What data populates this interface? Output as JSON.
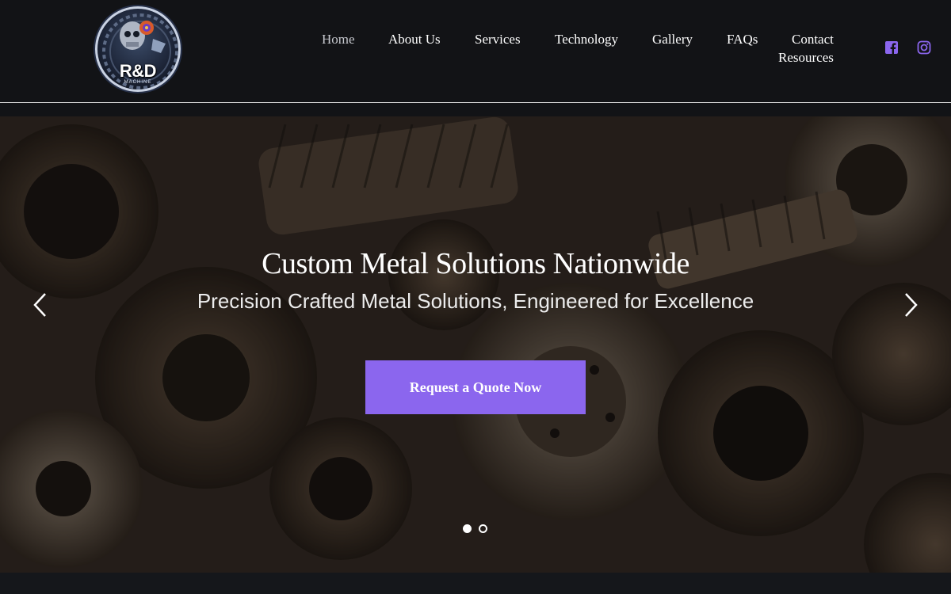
{
  "brand": {
    "logo_text": "R&D",
    "logo_sub": "MACHINE"
  },
  "nav": {
    "items": [
      {
        "label": "Home",
        "active": true
      },
      {
        "label": "About Us"
      },
      {
        "label": "Services"
      },
      {
        "label": "Technology"
      },
      {
        "label": "Gallery"
      },
      {
        "label": "FAQs"
      },
      {
        "label": "Contact"
      },
      {
        "label": "Resources"
      }
    ]
  },
  "social": {
    "icons": [
      "facebook-icon",
      "instagram-icon"
    ],
    "color": "#8b66ee"
  },
  "hero": {
    "title": "Custom Metal Solutions Nationwide",
    "subtitle": "Precision Crafted Metal Solutions, Engineered for Excellence",
    "cta_label": "Request a Quote Now",
    "cta_color": "#8b66ee",
    "prev_icon": "chevron-left-icon",
    "next_icon": "chevron-right-icon",
    "slides": 2,
    "active_slide": 1
  }
}
